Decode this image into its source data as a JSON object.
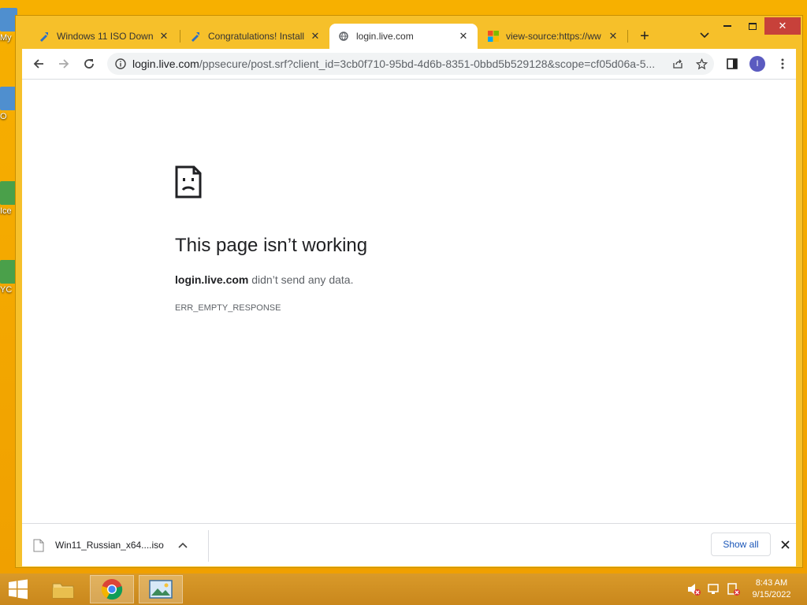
{
  "desktop": {
    "icons": [
      "My",
      "O",
      "Ice",
      "YC"
    ]
  },
  "browser": {
    "tabs": [
      {
        "title": "Windows 11 ISO Down",
        "favicon": "tool-icon"
      },
      {
        "title": "Congratulations! Install",
        "favicon": "tool-icon"
      },
      {
        "title": "login.live.com",
        "favicon": "globe-icon",
        "active": true
      },
      {
        "title": "view-source:https://ww",
        "favicon": "microsoft-icon"
      }
    ],
    "url": {
      "host": "login.live.com",
      "rest": "/ppsecure/post.srf?client_id=3cb0f710-95bd-4d6b-8351-0bbd5b529128&scope=cf05d06a-5..."
    },
    "profile_initial": "I"
  },
  "error_page": {
    "title": "This page isn’t working",
    "host": "login.live.com",
    "desc_suffix": " didn’t send any data.",
    "code": "ERR_EMPTY_RESPONSE"
  },
  "downloads": {
    "file_name": "Win11_Russian_x64....iso",
    "show_all": "Show all"
  },
  "taskbar": {
    "time": "8:43 AM",
    "date": "9/15/2022"
  },
  "colors": {
    "desktop": "#f2a800",
    "window_frame": "#f6c02a",
    "close_button": "#c7413a",
    "link_blue": "#1a56b8"
  }
}
